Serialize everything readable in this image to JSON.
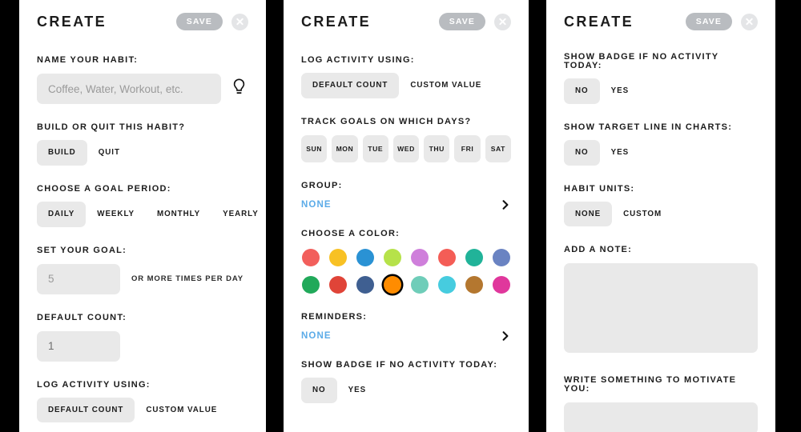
{
  "header": {
    "title": "CREATE",
    "save_label": "SAVE",
    "close_icon": "close-icon"
  },
  "panel1": {
    "name_habit": {
      "label": "NAME YOUR HABIT:",
      "placeholder": "Coffee, Water, Workout, etc.",
      "value": "",
      "hint_icon": "lightbulb-icon"
    },
    "build_or_quit": {
      "label": "BUILD OR QUIT THIS HABIT?",
      "options": [
        "BUILD",
        "QUIT"
      ],
      "selected": "BUILD"
    },
    "goal_period": {
      "label": "CHOOSE A GOAL PERIOD:",
      "options": [
        "DAILY",
        "WEEKLY",
        "MONTHLY",
        "YEARLY"
      ],
      "selected": "DAILY"
    },
    "set_goal": {
      "label": "SET YOUR GOAL:",
      "placeholder": "5",
      "value": "",
      "suffix": "OR MORE TIMES PER DAY"
    },
    "default_count": {
      "label": "DEFAULT COUNT:",
      "value": "1"
    },
    "log_activity": {
      "label": "LOG ACTIVITY USING:",
      "options": [
        "DEFAULT COUNT",
        "CUSTOM VALUE"
      ],
      "selected": "DEFAULT COUNT"
    }
  },
  "panel2": {
    "log_activity": {
      "label": "LOG ACTIVITY USING:",
      "options": [
        "DEFAULT COUNT",
        "CUSTOM VALUE"
      ],
      "selected": "DEFAULT COUNT"
    },
    "track_days": {
      "label": "TRACK GOALS ON WHICH DAYS?",
      "days": [
        "SUN",
        "MON",
        "TUE",
        "WED",
        "THU",
        "FRI",
        "SAT"
      ],
      "selected_days": [
        "SUN",
        "MON",
        "TUE",
        "WED",
        "THU",
        "FRI",
        "SAT"
      ]
    },
    "group": {
      "label": "GROUP:",
      "value": "NONE",
      "chevron_icon": "chevron-right-icon"
    },
    "choose_color": {
      "label": "CHOOSE A COLOR:",
      "swatches": [
        "#f25f5c",
        "#f8c124",
        "#2a92d4",
        "#b6e24a",
        "#cf7fdb",
        "#f45d56",
        "#21b399",
        "#6a83c2",
        "#21a95a",
        "#e04438",
        "#3f5f91",
        "#ff8c00",
        "#6fcdb9",
        "#46ccdf",
        "#b4772f",
        "#e0379c"
      ],
      "selected_index": 11
    },
    "reminders": {
      "label": "REMINDERS:",
      "value": "NONE",
      "chevron_icon": "chevron-right-icon"
    },
    "show_badge": {
      "label": "SHOW BADGE IF NO ACTIVITY TODAY:",
      "options": [
        "NO",
        "YES"
      ],
      "selected": "NO"
    }
  },
  "panel3": {
    "show_badge": {
      "label": "SHOW BADGE IF NO ACTIVITY TODAY:",
      "options": [
        "NO",
        "YES"
      ],
      "selected": "NO"
    },
    "target_line": {
      "label": "SHOW TARGET LINE IN CHARTS:",
      "options": [
        "NO",
        "YES"
      ],
      "selected": "NO"
    },
    "habit_units": {
      "label": "HABIT UNITS:",
      "options": [
        "NONE",
        "CUSTOM"
      ],
      "selected": "NONE"
    },
    "add_note": {
      "label": "ADD A NOTE:",
      "value": "",
      "placeholder": ""
    },
    "motivate": {
      "label": "WRITE SOMETHING TO MOTIVATE YOU:",
      "value": "",
      "placeholder": ""
    }
  },
  "colors": {
    "accent_link": "#5babe8",
    "field_bg": "#e9e9e9",
    "save_bg": "#b9bcc0",
    "text": "#1c1c1c"
  }
}
